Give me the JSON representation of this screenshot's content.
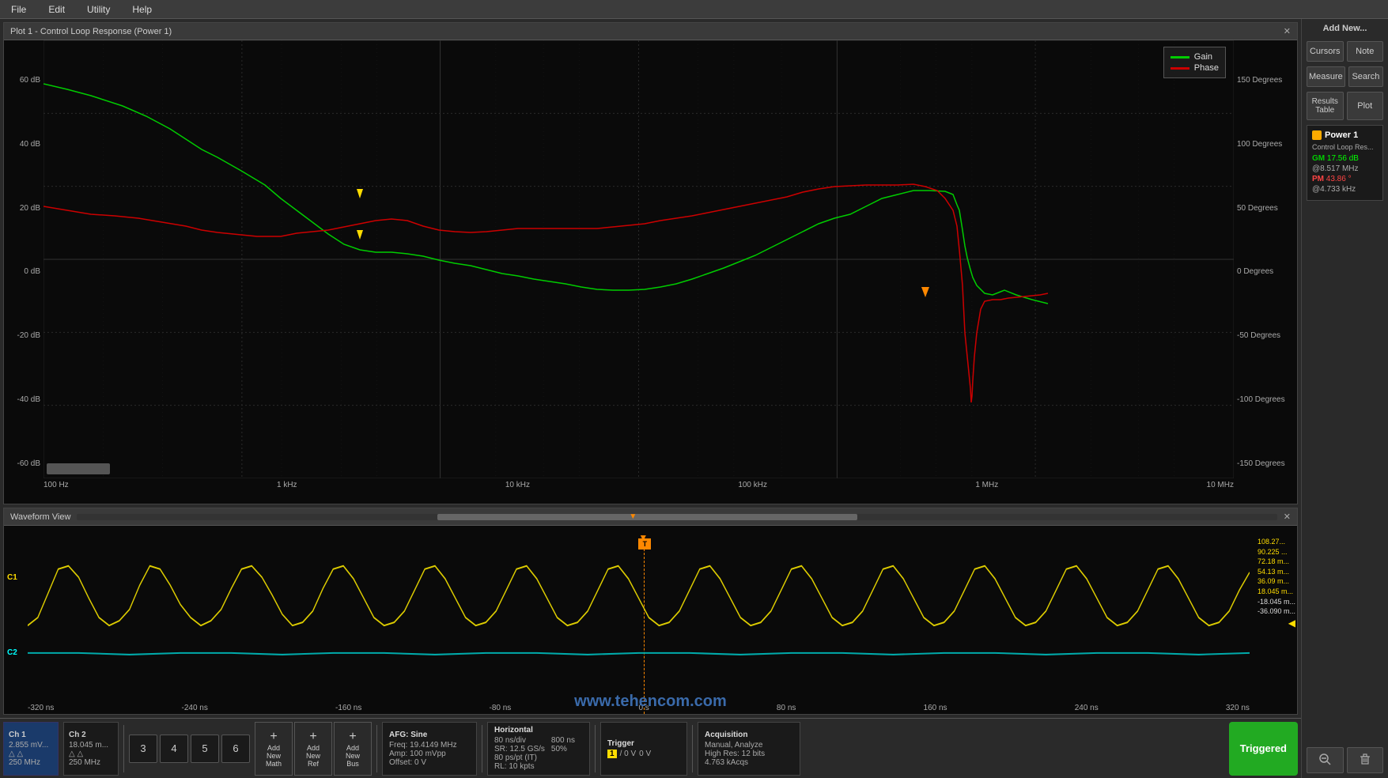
{
  "menubar": {
    "items": [
      "File",
      "Edit",
      "Utility",
      "Help"
    ]
  },
  "plot": {
    "title": "Plot 1 - Control Loop Response (Power 1)",
    "yaxis_left": [
      "60 dB",
      "40 dB",
      "20 dB",
      "0 dB",
      "-20 dB",
      "-40 dB",
      "-60 dB"
    ],
    "yaxis_right": [
      "150 Degrees",
      "100 Degrees",
      "50 Degrees",
      "0 Degrees",
      "-50 Degrees",
      "-100 Degrees",
      "-150 Degrees"
    ],
    "xaxis": [
      "100 Hz",
      "1 kHz",
      "10 kHz",
      "100 kHz",
      "1 MHz",
      "10 MHz"
    ],
    "legend": {
      "gain_label": "Gain",
      "gain_color": "#00cc00",
      "phase_label": "Phase",
      "phase_color": "#cc0000"
    }
  },
  "waveform": {
    "title": "Waveform View",
    "x_labels": [
      "-320 ns",
      "-240 ns",
      "-160 ns",
      "-80 ns",
      "0 s",
      "80 ns",
      "160 ns",
      "240 ns",
      "320 ns"
    ],
    "right_values": [
      "108.27...",
      "90.225 ...",
      "72.18 m...",
      "54.13 m...",
      "36.09 m...",
      "18.045 m...",
      "-18.045 m...",
      "-36.090 m..."
    ],
    "ch1_label": "C1",
    "ch2_label": "C2"
  },
  "status": {
    "ch1": {
      "title": "Ch 1",
      "value1": "2.855 mV...",
      "value2": "250 MHz"
    },
    "ch2": {
      "title": "Ch 2",
      "value1": "18.045 m...",
      "value2": "250 MHz"
    },
    "buttons": {
      "n3": "3",
      "n4": "4",
      "n5": "5",
      "n6": "6"
    },
    "add_new_math": "Add\nNew\nMath",
    "add_new_ref": "Add\nNew\nRef",
    "add_new_bus": "Add\nNew\nBus",
    "afg": {
      "title": "AFG: Sine",
      "freq": "Freq: 19.4149 MHz",
      "amp": "Amp: 100 mVpp",
      "offset": "Offset: 0 V"
    },
    "horizontal": {
      "title": "Horizontal",
      "nspdiv": "80 ns/div",
      "sr": "SR: 12.5 GS/s",
      "ps_pt": "80 ps/pt (IT)",
      "rl": "RL: 10 kpts",
      "period": "800 ns",
      "pct": "50%"
    },
    "trigger": {
      "title": "Trigger",
      "ch": "1",
      "level": "0 V"
    },
    "acquisition": {
      "title": "Acquisition",
      "mode": "Manual,  Analyze",
      "res": "High Res: 12 bits",
      "acqs": "4.763 kAcqs"
    },
    "triggered_label": "Triggered"
  },
  "sidebar": {
    "add_new_label": "Add New...",
    "cursors_label": "Cursors",
    "note_label": "Note",
    "measure_label": "Measure",
    "search_label": "Search",
    "results_table_label": "Results\nTable",
    "plot_label": "Plot",
    "power1": {
      "title": "Power 1",
      "subtitle": "Control Loop Res...",
      "gm_label": "GM",
      "gm_value": "17.56 dB",
      "gm_freq": "@8.517 MHz",
      "pm_label": "PM",
      "pm_value": "43.86 °",
      "pm_freq": "@4.733 kHz"
    },
    "zoom_minus": "−",
    "trash_label": "🗑"
  },
  "watermark": "www.tehencom.com"
}
